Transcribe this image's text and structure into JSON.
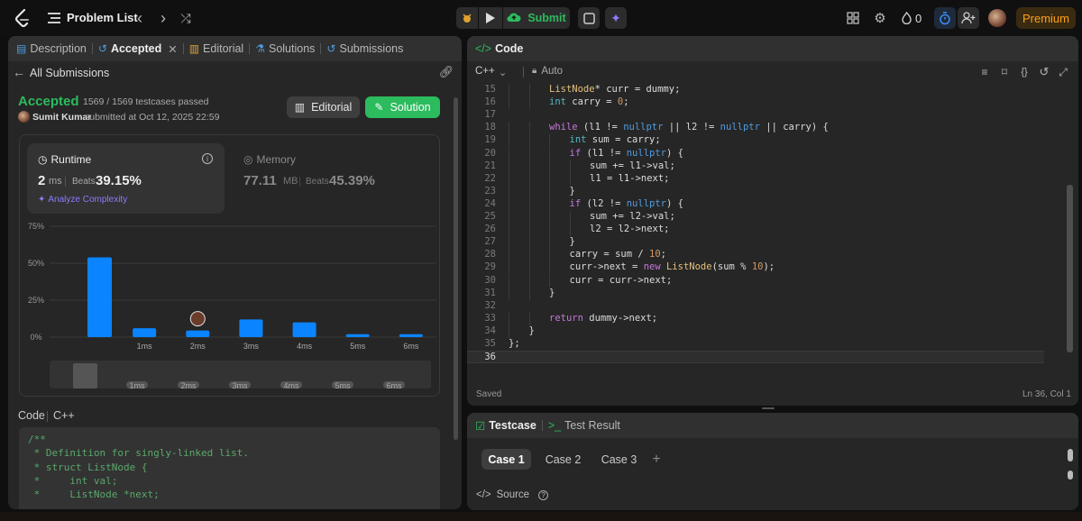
{
  "topbar": {
    "problem_list_label": "Problem List",
    "submit_label": "Submit",
    "streak_count": "0",
    "premium_label": "Premium"
  },
  "left": {
    "tabs": [
      {
        "label": "Description"
      },
      {
        "label": "Accepted"
      },
      {
        "label": "Editorial"
      },
      {
        "label": "Solutions"
      },
      {
        "label": "Submissions"
      }
    ],
    "all_submissions_label": "All Submissions",
    "status": "Accepted",
    "testcases": "1569 / 1569 testcases passed",
    "user": "Sumit Kumar",
    "submitted_at": "submitted at Oct 12, 2025 22:59",
    "editorial_button": "Editorial",
    "solution_button": "Solution",
    "runtime": {
      "label": "Runtime",
      "value": "2",
      "unit": "ms",
      "beats_label": "Beats",
      "beats": "39.15%",
      "analyze": "Analyze Complexity"
    },
    "memory": {
      "label": "Memory",
      "value": "77.11",
      "unit": "MB",
      "beats_label": "Beats",
      "beats": "45.39%"
    },
    "code_label": "Code",
    "code_lang": "C++",
    "code_lines": [
      "/**",
      " * Definition for singly-linked list.",
      " * struct ListNode {",
      " *     int val;",
      " *     ListNode *next;"
    ]
  },
  "chart_data": {
    "type": "bar",
    "y_ticks": [
      "75%",
      "50%",
      "25%",
      "0%"
    ],
    "ylim": [
      0,
      75
    ],
    "categories": [
      "",
      "1ms",
      "2ms",
      "3ms",
      "4ms",
      "5ms",
      "6ms"
    ],
    "values": [
      54,
      6,
      4.5,
      12,
      10,
      2,
      2
    ],
    "highlight_index": 2,
    "bar_color": "#0a84ff",
    "navigator_labels": [
      "1ms",
      "2ms",
      "3ms",
      "4ms",
      "5ms",
      "6ms"
    ]
  },
  "editor": {
    "title": "Code",
    "language": "C++",
    "mode": "Auto",
    "status": "Saved",
    "cursor": "Ln 36, Col 1",
    "lines": [
      {
        "n": "15",
        "indent": 2,
        "text": "ListNode* curr = dummy;"
      },
      {
        "n": "16",
        "indent": 2,
        "text": "int carry = 0;"
      },
      {
        "n": "17",
        "indent": 0,
        "text": ""
      },
      {
        "n": "18",
        "indent": 2,
        "text": "while (l1 != nullptr || l2 != nullptr || carry) {"
      },
      {
        "n": "19",
        "indent": 3,
        "text": "int sum = carry;"
      },
      {
        "n": "20",
        "indent": 3,
        "text": "if (l1 != nullptr) {"
      },
      {
        "n": "21",
        "indent": 4,
        "text": "sum += l1->val;"
      },
      {
        "n": "22",
        "indent": 4,
        "text": "l1 = l1->next;"
      },
      {
        "n": "23",
        "indent": 3,
        "text": "}"
      },
      {
        "n": "24",
        "indent": 3,
        "text": "if (l2 != nullptr) {"
      },
      {
        "n": "25",
        "indent": 4,
        "text": "sum += l2->val;"
      },
      {
        "n": "26",
        "indent": 4,
        "text": "l2 = l2->next;"
      },
      {
        "n": "27",
        "indent": 3,
        "text": "}"
      },
      {
        "n": "28",
        "indent": 3,
        "text": "carry = sum / 10;"
      },
      {
        "n": "29",
        "indent": 3,
        "text": "curr->next = new ListNode(sum % 10);"
      },
      {
        "n": "30",
        "indent": 3,
        "text": "curr = curr->next;"
      },
      {
        "n": "31",
        "indent": 2,
        "text": "}"
      },
      {
        "n": "32",
        "indent": 0,
        "text": ""
      },
      {
        "n": "33",
        "indent": 2,
        "text": "return dummy->next;"
      },
      {
        "n": "34",
        "indent": 1,
        "text": "}"
      },
      {
        "n": "35",
        "indent": 0,
        "text": "};"
      },
      {
        "n": "36",
        "indent": 0,
        "text": ""
      }
    ]
  },
  "testpanel": {
    "testcase_tab": "Testcase",
    "result_tab": "Test Result",
    "cases": [
      "Case 1",
      "Case 2",
      "Case 3"
    ],
    "add": "+",
    "source_label": "Source"
  }
}
